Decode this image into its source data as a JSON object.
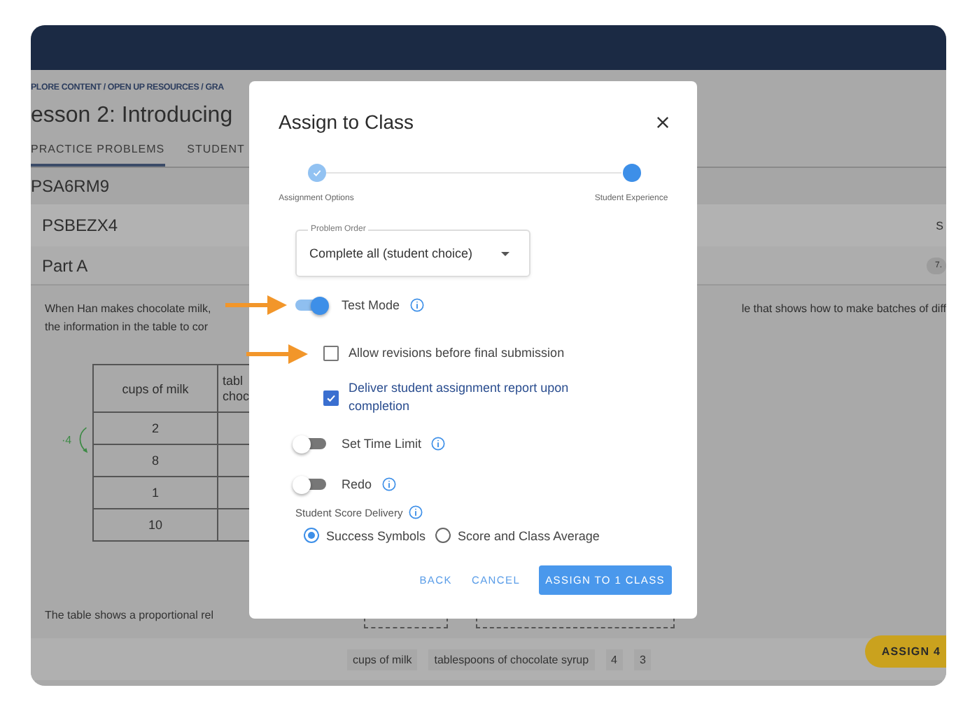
{
  "breadcrumb": "PLORE CONTENT / OPEN UP RESOURCES / GRA",
  "lesson_title": "esson 2: Introducing",
  "tabs": [
    {
      "label": "PRACTICE PROBLEMS",
      "selected": true
    },
    {
      "label": "STUDENT",
      "selected": false
    }
  ],
  "problem_set": {
    "set_code": "PSA6RM9",
    "problem_code": "PSBEZX4",
    "problem_code_right": "S",
    "part": "Part A",
    "part_badge": "7."
  },
  "prompt": {
    "line_1_left": "When Han makes chocolate milk,",
    "line_1_right": "le that shows how to make batches of diff",
    "line_2_left": "the information in the table to cor"
  },
  "table": {
    "columns": [
      "cups of milk",
      [
        "tabl",
        "choc"
      ]
    ],
    "rows": [
      "2",
      "8",
      "1",
      "10"
    ],
    "annotation": "·4"
  },
  "statement": "The table shows a proportional rel",
  "answer_strip": [
    "cups of milk",
    "tablespoons of chocolate syrup",
    "4",
    "3"
  ],
  "assign_button": "ASSIGN 4",
  "modal": {
    "title": "Assign to Class",
    "steps": [
      {
        "label": "Assignment Options",
        "selected": false
      },
      {
        "label": "Student Experience",
        "selected": true
      }
    ],
    "problem_order": {
      "label": "Problem Order",
      "value": "Complete all (student choice)"
    },
    "options": [
      {
        "kind": "toggle",
        "label": "Test Mode",
        "on": true,
        "info": true,
        "callout_arrow": true
      },
      {
        "kind": "checkbox",
        "label": "Allow revisions before final submission",
        "checked": false,
        "callout_arrow": true
      },
      {
        "kind": "checkbox",
        "label": "Deliver student assignment report upon completion",
        "checked": true,
        "callout_arrow": false
      },
      {
        "kind": "toggle",
        "label": "Set Time Limit",
        "on": false,
        "info": true,
        "callout_arrow": false
      },
      {
        "kind": "toggle",
        "label": "Redo",
        "on": false,
        "info": true,
        "callout_arrow": false
      }
    ],
    "score_delivery": {
      "label": "Student Score Delivery",
      "choices": [
        {
          "label": "Success Symbols",
          "selected": true
        },
        {
          "label": "Score and Class Average",
          "selected": false
        }
      ]
    },
    "buttons": [
      {
        "kind": "text",
        "label": "BACK"
      },
      {
        "kind": "text",
        "label": "CANCEL"
      },
      {
        "kind": "primary",
        "label": "ASSIGN TO 1 CLASS"
      }
    ]
  }
}
